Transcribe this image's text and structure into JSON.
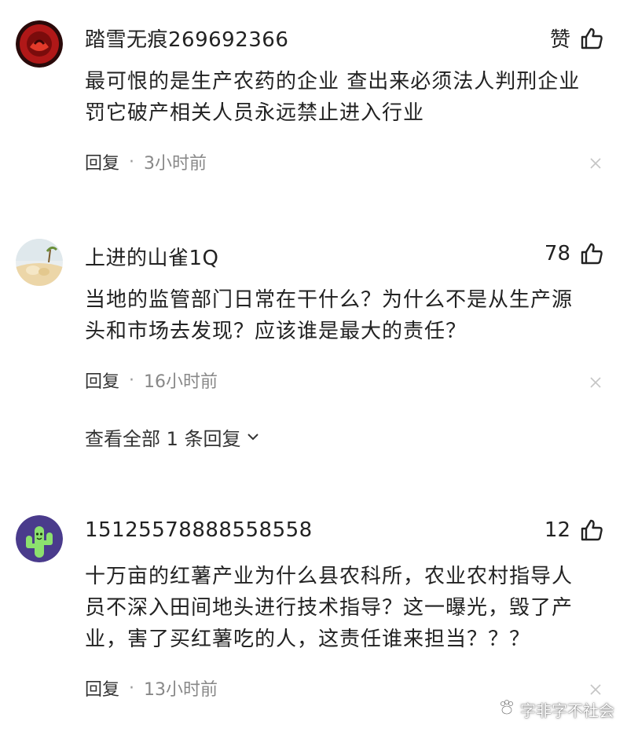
{
  "colors": {
    "text": "#222222",
    "meta": "#888888",
    "avatar1_bg": "#b01818",
    "avatar3_bg": "#4a3b8c",
    "avatar3_cactus": "#8ce06e"
  },
  "comments": [
    {
      "username": "踏雪无痕269692366",
      "like_label": "赞",
      "like_icon": "thumbs-up-icon",
      "text": "最可恨的是生产农药的企业 查出来必须法人判刑企业\n罚它破产相关人员永远禁止进入行业",
      "reply_label": "回复",
      "separator": "·",
      "time": "3小时前",
      "close_icon": "close-icon"
    },
    {
      "username": "上进的山雀1Q",
      "like_label": "78",
      "like_icon": "thumbs-up-icon",
      "text": "当地的监管部门日常在干什么？为什么不是从生产源\n头和市场去发现？应该谁是最大的责任？",
      "reply_label": "回复",
      "separator": "·",
      "time": "16小时前",
      "close_icon": "close-icon",
      "expand_label": "查看全部 1 条回复"
    },
    {
      "username": "15125578888558558",
      "like_label": "12",
      "like_icon": "thumbs-up-icon",
      "text": "十万亩的红薯产业为什么县农科所，农业农村指导人\n员不深入田间地头进行技术指导？这一曝光，毁了产\n业，害了买红薯吃的人，这责任谁来担当？？？",
      "reply_label": "回复",
      "separator": "·",
      "time": "13小时前",
      "close_icon": "close-icon"
    }
  ],
  "watermark": {
    "text": "字非字不社会",
    "icon": "paw-logo-icon"
  }
}
